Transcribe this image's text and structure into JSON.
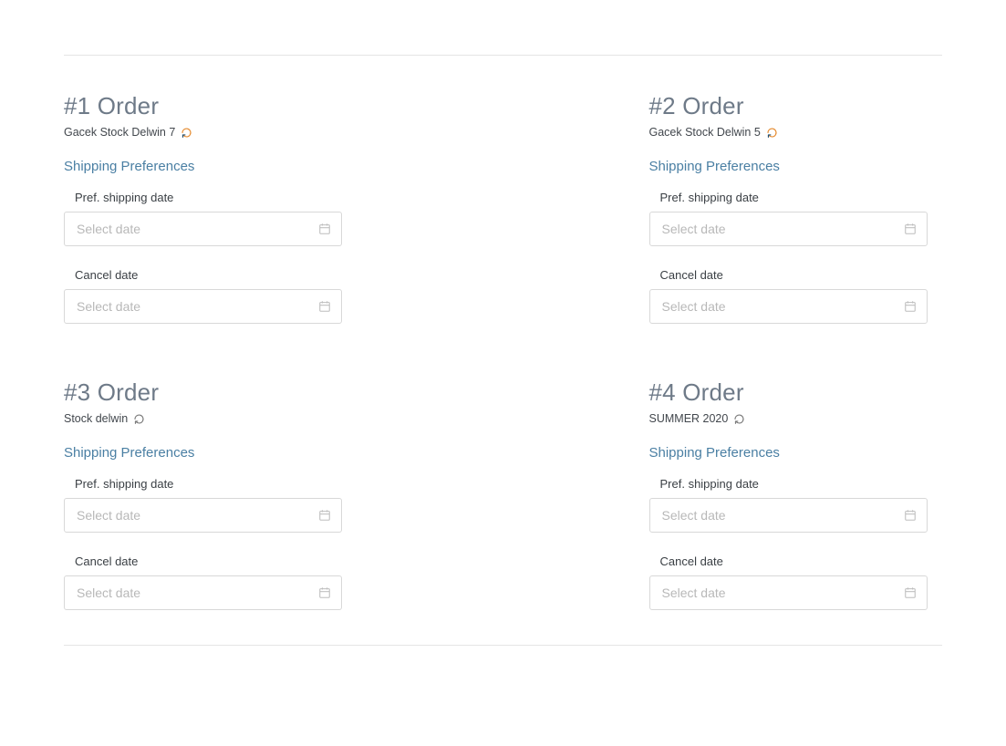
{
  "orders": [
    {
      "title": "#1 Order",
      "subtitle": "Gacek Stock Delwin 7",
      "refresh_colored": true,
      "section_heading": "Shipping Preferences",
      "pref_date_label": "Pref. shipping date",
      "pref_date_placeholder": "Select date",
      "cancel_date_label": "Cancel date",
      "cancel_date_placeholder": "Select date"
    },
    {
      "title": "#2 Order",
      "subtitle": "Gacek Stock Delwin 5",
      "refresh_colored": true,
      "section_heading": "Shipping Preferences",
      "pref_date_label": "Pref. shipping date",
      "pref_date_placeholder": "Select date",
      "cancel_date_label": "Cancel date",
      "cancel_date_placeholder": "Select date"
    },
    {
      "title": "#3 Order",
      "subtitle": "Stock delwin",
      "refresh_colored": false,
      "section_heading": "Shipping Preferences",
      "pref_date_label": "Pref. shipping date",
      "pref_date_placeholder": "Select date",
      "cancel_date_label": "Cancel date",
      "cancel_date_placeholder": "Select date"
    },
    {
      "title": "#4 Order",
      "subtitle": "SUMMER 2020",
      "refresh_colored": false,
      "section_heading": "Shipping Preferences",
      "pref_date_label": "Pref. shipping date",
      "pref_date_placeholder": "Select date",
      "cancel_date_label": "Cancel date",
      "cancel_date_placeholder": "Select date"
    }
  ]
}
